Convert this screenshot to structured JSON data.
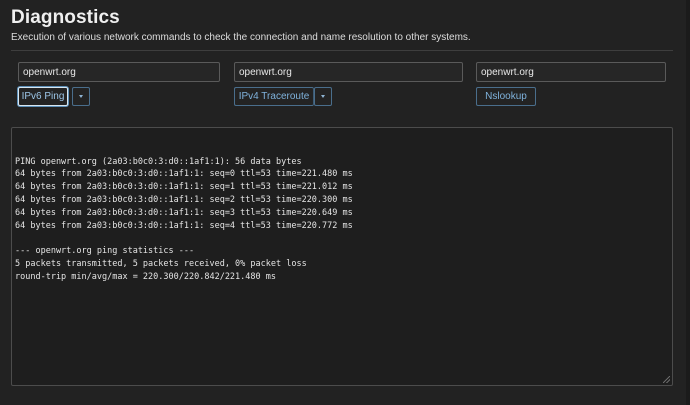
{
  "page": {
    "title": "Diagnostics",
    "description": "Execution of various network commands to check the connection and name resolution to other systems."
  },
  "tools": {
    "ping": {
      "host_value": "openwrt.org",
      "button_label": "IPv6 Ping"
    },
    "traceroute": {
      "host_value": "openwrt.org",
      "button_label": "IPv4 Traceroute"
    },
    "nslookup": {
      "host_value": "openwrt.org",
      "button_label": "Nslookup"
    }
  },
  "output": {
    "lines": [
      "PING openwrt.org (2a03:b0c0:3:d0::1af1:1): 56 data bytes",
      "64 bytes from 2a03:b0c0:3:d0::1af1:1: seq=0 ttl=53 time=221.480 ms",
      "64 bytes from 2a03:b0c0:3:d0::1af1:1: seq=1 ttl=53 time=221.012 ms",
      "64 bytes from 2a03:b0c0:3:d0::1af1:1: seq=2 ttl=53 time=220.300 ms",
      "64 bytes from 2a03:b0c0:3:d0::1af1:1: seq=3 ttl=53 time=220.649 ms",
      "64 bytes from 2a03:b0c0:3:d0::1af1:1: seq=4 ttl=53 time=220.772 ms",
      "",
      "--- openwrt.org ping statistics ---",
      "5 packets transmitted, 5 packets received, 0% packet loss",
      "round-trip min/avg/max = 220.300/220.842/221.480 ms"
    ]
  },
  "theme": {
    "background": "#222222",
    "accent": "#7fb2dc",
    "border": "#4a6e8c"
  }
}
